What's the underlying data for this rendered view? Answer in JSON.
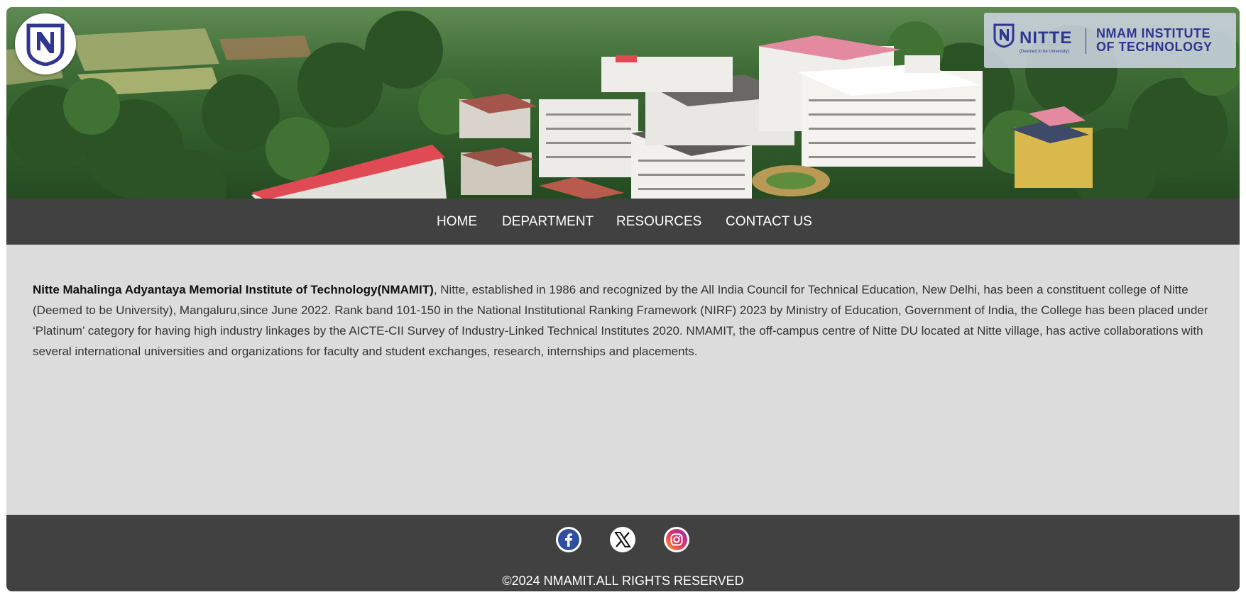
{
  "header": {
    "logo_icon": "nitte-n-shield-logo",
    "brand": {
      "name": "NITTE",
      "subtitle": "(Deemed to be University)",
      "institute_line1": "NMAM INSTITUTE",
      "institute_line2": "OF TECHNOLOGY",
      "color": "#2f3690"
    }
  },
  "nav": {
    "items": [
      {
        "label": "HOME"
      },
      {
        "label": "DEPARTMENT"
      },
      {
        "label": "RESOURCES"
      },
      {
        "label": "CONTACT US"
      }
    ],
    "background": "#414141"
  },
  "main": {
    "intro_bold": "Nitte Mahalinga Adyantaya Memorial Institute of Technology(NMAMIT)",
    "intro_text": ", Nitte, established in 1986 and recognized by the All India Council for Technical Education, New Delhi, has been a constituent college of Nitte (Deemed to be University), Mangaluru,since June 2022. Rank band 101-150 in the National Institutional Ranking Framework (NIRF) 2023 by Ministry of Education, Government of India, the College has been placed under ‘Platinum’ category for having high industry linkages by the AICTE-CII Survey of Industry-Linked Technical Institutes 2020. NMAMIT, the off-campus centre of Nitte DU located at Nitte village, has active collaborations with several international universities and organizations for faculty and student exchanges, research, internships and placements.",
    "background": "#dcdcdc"
  },
  "footer": {
    "social": [
      {
        "icon": "facebook-icon"
      },
      {
        "icon": "x-twitter-icon"
      },
      {
        "icon": "instagram-icon"
      }
    ],
    "copyright": "©2024 NMAMIT.ALL RIGHTS RESERVED"
  }
}
